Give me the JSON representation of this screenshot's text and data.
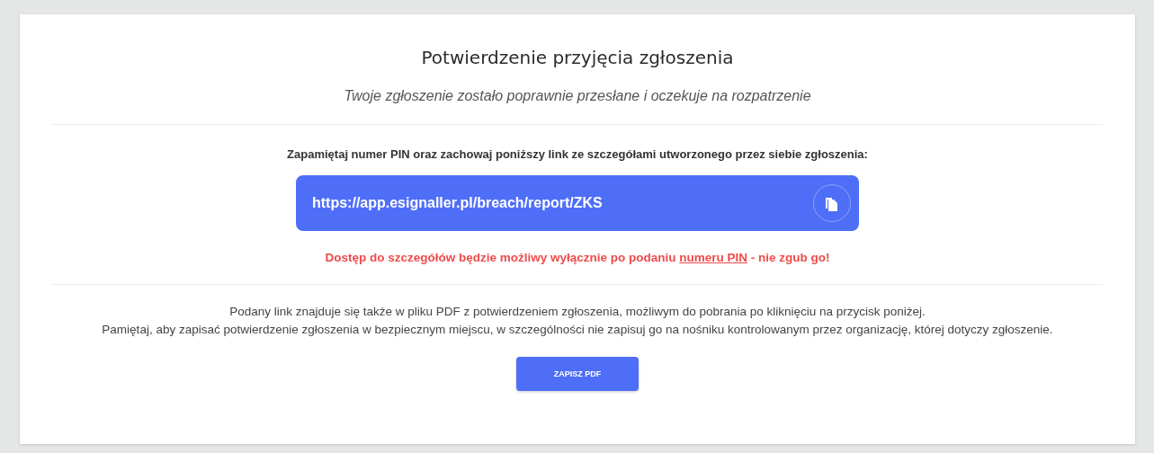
{
  "title": "Potwierdzenie przyjęcia zgłoszenia",
  "subtitle": "Twoje zgłoszenie zostało poprawnie przesłane i oczekuje na rozpatrzenie",
  "instruction": "Zapamiętaj numer PIN oraz zachowaj poniższy link ze szczegółami utworzonego przez siebie zgłoszenia:",
  "report_link": {
    "url": "https://app.esignaller.pl/breach/report/ZKS"
  },
  "warning": {
    "before": "Dostęp do szczegółów będzie możliwy wyłącznie po podaniu ",
    "link": "numeru PIN",
    "after": " - nie zgub go!"
  },
  "notes": [
    "Podany link znajduje się także w pliku PDF z potwierdzeniem zgłoszenia, możliwym do pobrania po kliknięciu na przycisk poniżej.",
    "Pamiętaj, aby zapisać potwierdzenie zgłoszenia w bezpiecznym miejscu, w szczególności nie zapisuj go na nośniku kontrolowanym przez organizację, której dotyczy zgłoszenie."
  ],
  "button": "ZAPISZ PDF"
}
